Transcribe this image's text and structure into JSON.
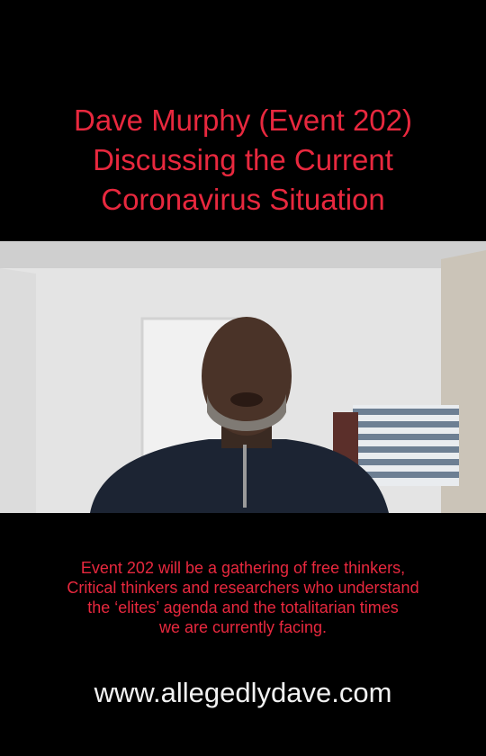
{
  "title": {
    "lines": [
      "Dave Murphy (Event 202)",
      "Discussing the Current",
      "Coronavirus Situation"
    ]
  },
  "caption": {
    "lines": [
      "Event 202 will be a gathering of free thinkers,",
      "Critical thinkers and researchers who understand",
      "the ‘elites’ agenda and the totalitarian times",
      "we are currently facing."
    ]
  },
  "website": "www.allegedlydave.com",
  "colors": {
    "background": "#000000",
    "accent_text": "#e8283e",
    "website_text": "#f2f2f2"
  }
}
